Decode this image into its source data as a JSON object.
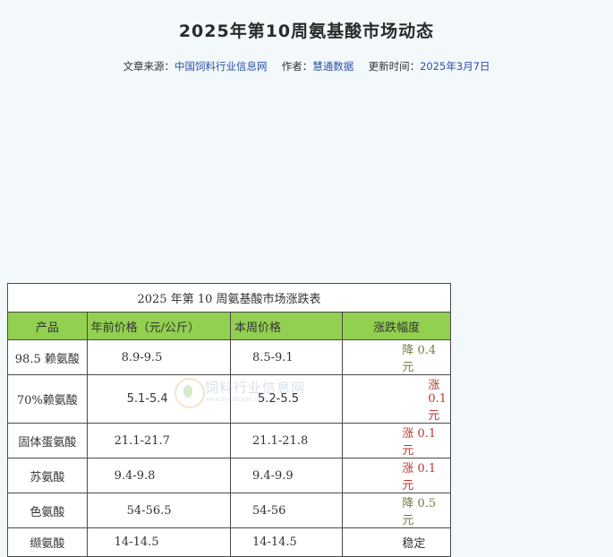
{
  "article": {
    "title": "2025年第10周氨基酸市场动态",
    "source_label": "文章来源：",
    "source_value": "中国饲料行业信息网",
    "author_label": "作者：",
    "author_value": "慧通数据",
    "updated_label": "更新时间：",
    "updated_value": "2025年3月7日"
  },
  "table": {
    "caption": "2025 年第 10 周氨基酸市场涨跌表",
    "headers": [
      "产品",
      "年前价格（元/公斤）",
      "本周价格",
      "涨跌幅度"
    ],
    "rows": [
      {
        "product": "98.5 赖氨酸",
        "prev": "8.9-9.5",
        "current": "8.5-9.1",
        "change": "降 0.4 元",
        "trend": "down"
      },
      {
        "product": "70%赖氨酸",
        "prev": "5.1-5.4",
        "current": "5.2-5.5",
        "change": "涨 0.1 元",
        "trend": "up"
      },
      {
        "product": "固体蛋氨酸",
        "prev": "21.1-21.7",
        "current": "21.1-21.8",
        "change": "涨 0.1 元",
        "trend": "up"
      },
      {
        "product": "苏氨酸",
        "prev": "9.4-9.8",
        "current": "9.4-9.9",
        "change": "涨 0.1 元",
        "trend": "up"
      },
      {
        "product": "色氨酸",
        "prev": "54-56.5",
        "current": "54-56",
        "change": "降 0.5 元",
        "trend": "down"
      },
      {
        "product": "缬氨酸",
        "prev": "14-14.5",
        "current": "14-14.5",
        "change": "稳定",
        "trend": "flat"
      }
    ]
  },
  "watermark": {
    "text": "饲料行业信息网",
    "url": "www.feedtrade.com.cn"
  }
}
